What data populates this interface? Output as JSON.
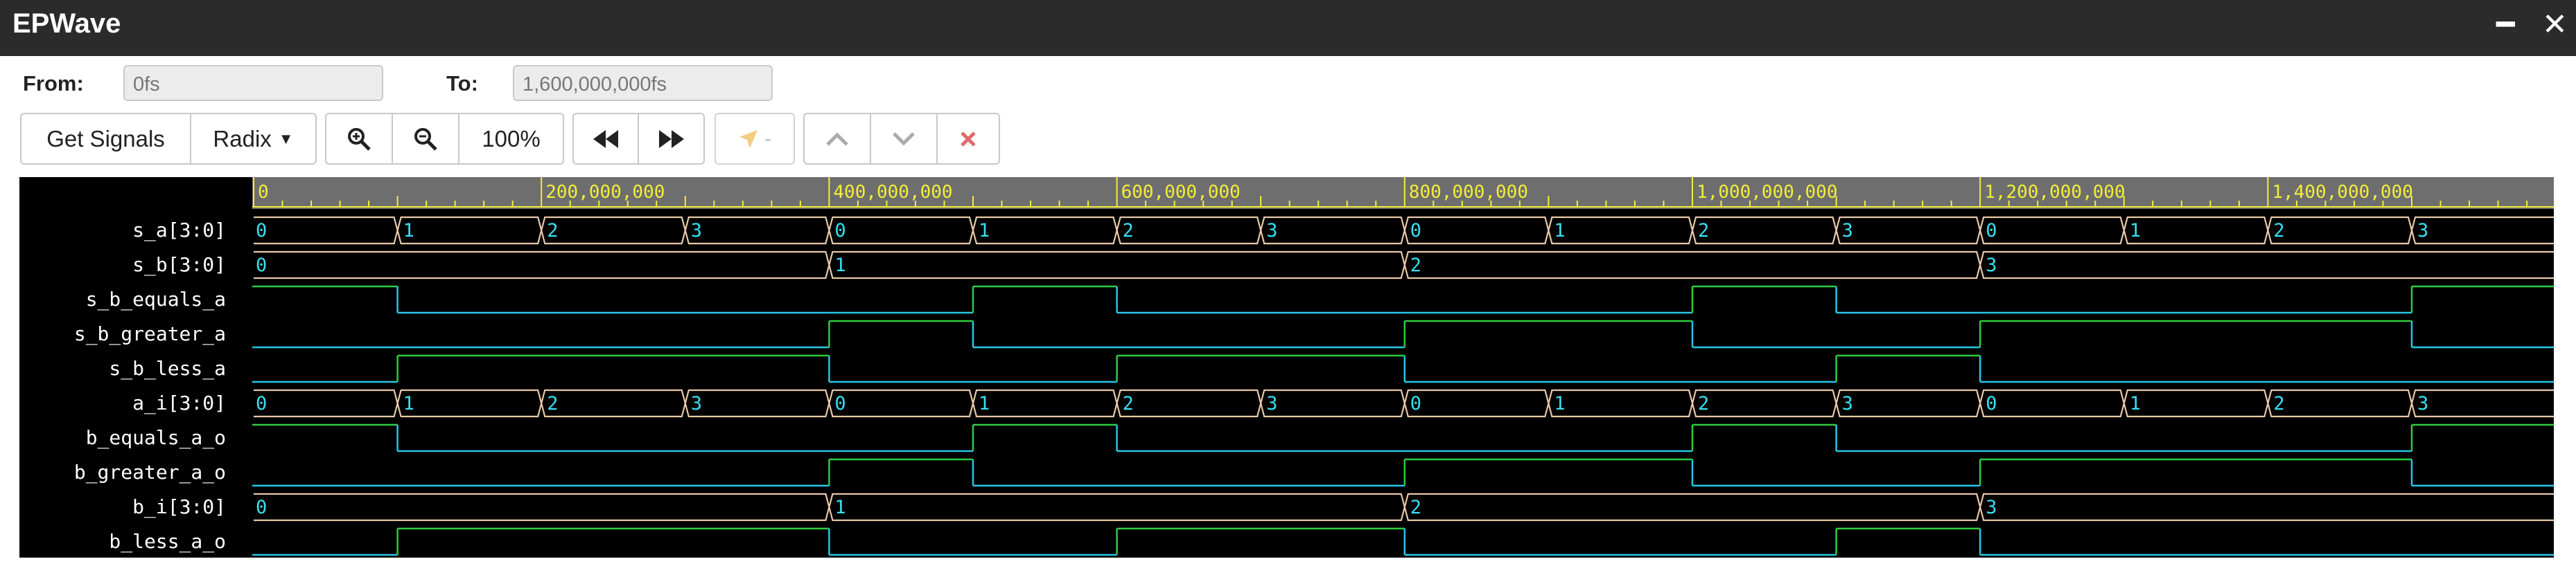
{
  "window": {
    "title": "EPWave",
    "minimize_icon": "minimize-icon",
    "close_icon": "close-icon"
  },
  "range": {
    "from_label": "From:",
    "from_value": "0fs",
    "to_label": "To:",
    "to_value": "1,600,000,000fs"
  },
  "toolbar": {
    "get_signals": "Get Signals",
    "radix": "Radix",
    "zoom_level": "100%",
    "icons": [
      "zoom-in-icon",
      "zoom-out-icon",
      "rewind-icon",
      "fast-forward-icon",
      "cursor-icon",
      "chevron-up-icon",
      "chevron-down-icon",
      "delete-icon"
    ],
    "cursor_suffix": "-"
  },
  "timeline": {
    "t_max": 1600000000,
    "ticks": [
      {
        "t": 0,
        "label": "0"
      },
      {
        "t": 200000000,
        "label": "200,000,000"
      },
      {
        "t": 400000000,
        "label": "400,000,000"
      },
      {
        "t": 600000000,
        "label": "600,000,000"
      },
      {
        "t": 800000000,
        "label": "800,000,000"
      },
      {
        "t": 1000000000,
        "label": "1,000,000,000"
      },
      {
        "t": 1200000000,
        "label": "1,200,000,000"
      },
      {
        "t": 1400000000,
        "label": "1,400,000,000"
      }
    ]
  },
  "signals": [
    {
      "name": "s_a[3:0]",
      "type": "bus",
      "segments": [
        {
          "t": 0,
          "v": "0"
        },
        {
          "t": 100000000,
          "v": "1"
        },
        {
          "t": 200000000,
          "v": "2"
        },
        {
          "t": 300000000,
          "v": "3"
        },
        {
          "t": 400000000,
          "v": "0"
        },
        {
          "t": 500000000,
          "v": "1"
        },
        {
          "t": 600000000,
          "v": "2"
        },
        {
          "t": 700000000,
          "v": "3"
        },
        {
          "t": 800000000,
          "v": "0"
        },
        {
          "t": 900000000,
          "v": "1"
        },
        {
          "t": 1000000000,
          "v": "2"
        },
        {
          "t": 1100000000,
          "v": "3"
        },
        {
          "t": 1200000000,
          "v": "0"
        },
        {
          "t": 1300000000,
          "v": "1"
        },
        {
          "t": 1400000000,
          "v": "2"
        },
        {
          "t": 1500000000,
          "v": "3"
        }
      ]
    },
    {
      "name": "s_b[3:0]",
      "type": "bus",
      "segments": [
        {
          "t": 0,
          "v": "0"
        },
        {
          "t": 400000000,
          "v": "1"
        },
        {
          "t": 800000000,
          "v": "2"
        },
        {
          "t": 1200000000,
          "v": "3"
        }
      ]
    },
    {
      "name": "s_b_equals_a",
      "type": "bit",
      "initial": 1,
      "transitions": [
        {
          "t": 100000000,
          "v": 0
        },
        {
          "t": 500000000,
          "v": 1
        },
        {
          "t": 600000000,
          "v": 0
        },
        {
          "t": 1000000000,
          "v": 1
        },
        {
          "t": 1100000000,
          "v": 0
        },
        {
          "t": 1500000000,
          "v": 1
        }
      ]
    },
    {
      "name": "s_b_greater_a",
      "type": "bit",
      "initial": 0,
      "transitions": [
        {
          "t": 400000000,
          "v": 1
        },
        {
          "t": 500000000,
          "v": 0
        },
        {
          "t": 800000000,
          "v": 1
        },
        {
          "t": 1000000000,
          "v": 0
        },
        {
          "t": 1200000000,
          "v": 1
        },
        {
          "t": 1500000000,
          "v": 0
        }
      ]
    },
    {
      "name": "s_b_less_a",
      "type": "bit",
      "initial": 0,
      "transitions": [
        {
          "t": 100000000,
          "v": 1
        },
        {
          "t": 400000000,
          "v": 0
        },
        {
          "t": 600000000,
          "v": 1
        },
        {
          "t": 800000000,
          "v": 0
        },
        {
          "t": 1100000000,
          "v": 1
        },
        {
          "t": 1200000000,
          "v": 0
        }
      ]
    },
    {
      "name": "a_i[3:0]",
      "type": "bus",
      "segments": [
        {
          "t": 0,
          "v": "0"
        },
        {
          "t": 100000000,
          "v": "1"
        },
        {
          "t": 200000000,
          "v": "2"
        },
        {
          "t": 300000000,
          "v": "3"
        },
        {
          "t": 400000000,
          "v": "0"
        },
        {
          "t": 500000000,
          "v": "1"
        },
        {
          "t": 600000000,
          "v": "2"
        },
        {
          "t": 700000000,
          "v": "3"
        },
        {
          "t": 800000000,
          "v": "0"
        },
        {
          "t": 900000000,
          "v": "1"
        },
        {
          "t": 1000000000,
          "v": "2"
        },
        {
          "t": 1100000000,
          "v": "3"
        },
        {
          "t": 1200000000,
          "v": "0"
        },
        {
          "t": 1300000000,
          "v": "1"
        },
        {
          "t": 1400000000,
          "v": "2"
        },
        {
          "t": 1500000000,
          "v": "3"
        }
      ]
    },
    {
      "name": "b_equals_a_o",
      "type": "bit",
      "initial": 1,
      "transitions": [
        {
          "t": 100000000,
          "v": 0
        },
        {
          "t": 500000000,
          "v": 1
        },
        {
          "t": 600000000,
          "v": 0
        },
        {
          "t": 1000000000,
          "v": 1
        },
        {
          "t": 1100000000,
          "v": 0
        },
        {
          "t": 1500000000,
          "v": 1
        }
      ]
    },
    {
      "name": "b_greater_a_o",
      "type": "bit",
      "initial": 0,
      "transitions": [
        {
          "t": 400000000,
          "v": 1
        },
        {
          "t": 500000000,
          "v": 0
        },
        {
          "t": 800000000,
          "v": 1
        },
        {
          "t": 1000000000,
          "v": 0
        },
        {
          "t": 1200000000,
          "v": 1
        },
        {
          "t": 1500000000,
          "v": 0
        }
      ]
    },
    {
      "name": "b_i[3:0]",
      "type": "bus",
      "segments": [
        {
          "t": 0,
          "v": "0"
        },
        {
          "t": 400000000,
          "v": "1"
        },
        {
          "t": 800000000,
          "v": "2"
        },
        {
          "t": 1200000000,
          "v": "3"
        }
      ]
    },
    {
      "name": "b_less_a_o",
      "type": "bit",
      "initial": 0,
      "transitions": [
        {
          "t": 100000000,
          "v": 1
        },
        {
          "t": 400000000,
          "v": 0
        },
        {
          "t": 600000000,
          "v": 1
        },
        {
          "t": 800000000,
          "v": 0
        },
        {
          "t": 1100000000,
          "v": 1
        },
        {
          "t": 1200000000,
          "v": 0
        }
      ]
    }
  ],
  "colors": {
    "bus": "#e8c9a8",
    "bus_text": "#36e0f0",
    "high": "#2ecc40",
    "low": "#27c6e6",
    "ruler": "#f2ee3a",
    "ruler_bg": "#6e6e6e",
    "wave_bg": "#000000",
    "delete": "#e06a6a",
    "cursor": "#f0c060"
  }
}
